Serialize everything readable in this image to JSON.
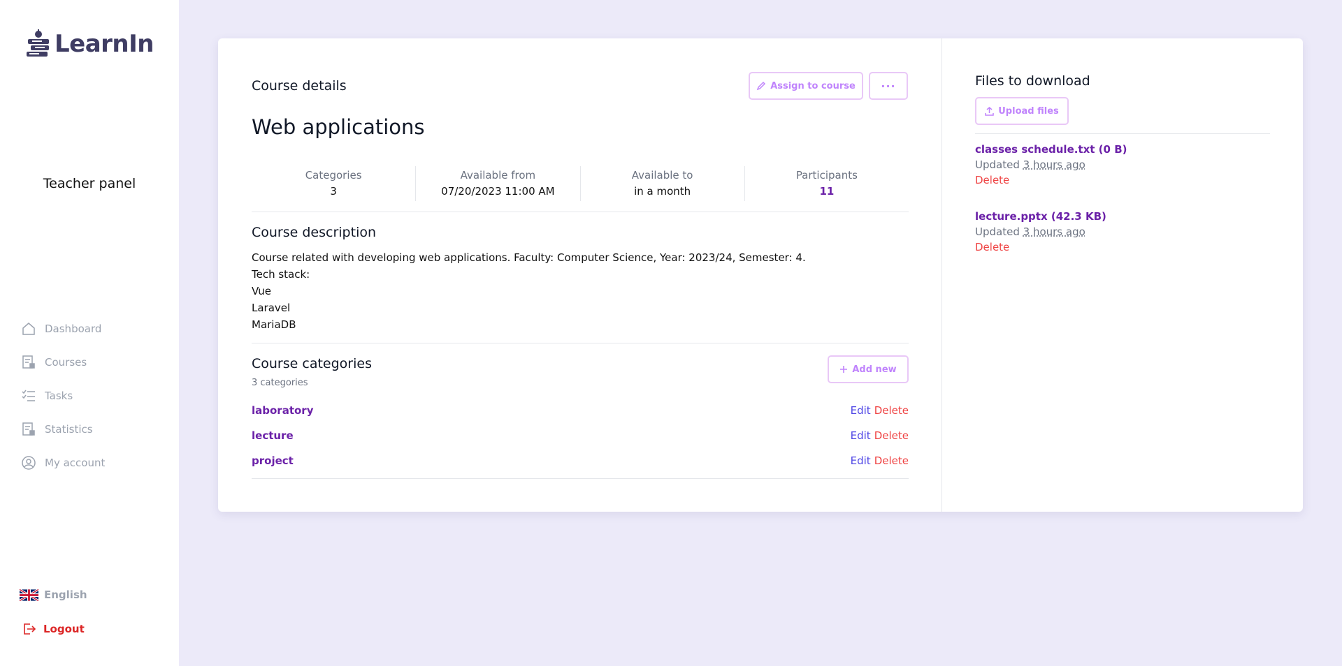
{
  "app": {
    "name": "LearnIn"
  },
  "sidebar": {
    "panel_title": "Teacher panel",
    "items": [
      {
        "label": "Dashboard",
        "icon": "home-icon"
      },
      {
        "label": "Courses",
        "icon": "courses-icon"
      },
      {
        "label": "Tasks",
        "icon": "tasks-icon"
      },
      {
        "label": "Statistics",
        "icon": "statistics-icon"
      },
      {
        "label": "My account",
        "icon": "account-icon"
      }
    ],
    "language": "English",
    "logout": "Logout"
  },
  "course": {
    "section_title": "Course details",
    "assign_label": "Assign to course",
    "more_label": "···",
    "title": "Web applications",
    "stats": {
      "categories_label": "Categories",
      "categories_value": "3",
      "from_label": "Available from",
      "from_value": "07/20/2023 11:00 AM",
      "to_label": "Available to",
      "to_value": "in a month",
      "participants_label": "Participants",
      "participants_value": "11"
    },
    "description_title": "Course description",
    "description_lines": [
      "Course related with developing web applications. Faculty: Computer Science, Year: 2023/24, Semester: 4.",
      "Tech stack:",
      "Vue",
      "Laravel",
      "MariaDB"
    ],
    "categories_title": "Course categories",
    "categories_count": "3 categories",
    "add_new_label": "Add new",
    "edit_label": "Edit",
    "delete_label": "Delete",
    "categories": [
      {
        "name": "laboratory"
      },
      {
        "name": "lecture"
      },
      {
        "name": "project"
      }
    ]
  },
  "files": {
    "title": "Files to download",
    "upload_label": "Upload files",
    "items": [
      {
        "name": "classes schedule.txt (0 B)",
        "updated_prefix": "Updated",
        "updated_rel": "3 hours ago",
        "delete": "Delete"
      },
      {
        "name": "lecture.pptx (42.3 KB)",
        "updated_prefix": "Updated",
        "updated_rel": "3 hours ago",
        "delete": "Delete"
      }
    ]
  },
  "colors": {
    "accent": "#6b21a8",
    "button_border": "#e9c8f7",
    "danger": "#ef4444",
    "link": "#4f46e5",
    "background": "#eceaf9"
  }
}
